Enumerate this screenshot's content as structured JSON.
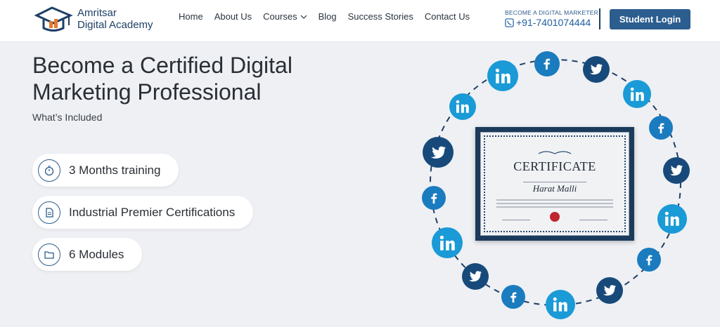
{
  "header": {
    "logo_line1": "Amritsar",
    "logo_line2": "Digital Academy",
    "nav": [
      {
        "label": "Home"
      },
      {
        "label": "About Us"
      },
      {
        "label": "Courses"
      },
      {
        "label": "Blog"
      },
      {
        "label": "Success Stories"
      },
      {
        "label": "Contact Us"
      }
    ],
    "contact_label": "BECOME A DIGITAL MARKETER",
    "contact_phone": "+91-7401074444",
    "login_label": "Student Login"
  },
  "hero": {
    "title": "Become a Certified Digital Marketing Professional",
    "subtitle": "What’s Included",
    "features": [
      {
        "label": "3 Months training",
        "icon": "stopwatch-icon"
      },
      {
        "label": "Industrial Premier Certifications",
        "icon": "document-icon"
      },
      {
        "label": "6 Modules",
        "icon": "folder-icon"
      }
    ]
  },
  "certificate": {
    "title": "CERTIFICATE",
    "name": "Harat Malli"
  },
  "social_icons": [
    {
      "type": "linkedin",
      "color": "#1a9ad6"
    },
    {
      "type": "facebook",
      "color": "#1a7bbf"
    },
    {
      "type": "twitter",
      "color": "#174a7a"
    },
    {
      "type": "linkedin",
      "color": "#1a9ad6"
    },
    {
      "type": "facebook",
      "color": "#1a7bbf"
    },
    {
      "type": "twitter",
      "color": "#174a7a"
    },
    {
      "type": "linkedin",
      "color": "#1a9ad6"
    },
    {
      "type": "facebook",
      "color": "#1a7bbf"
    },
    {
      "type": "twitter",
      "color": "#174a7a"
    },
    {
      "type": "linkedin",
      "color": "#1a9ad6"
    },
    {
      "type": "facebook",
      "color": "#1a7bbf"
    },
    {
      "type": "twitter",
      "color": "#174a7a"
    },
    {
      "type": "linkedin",
      "color": "#1a9ad6"
    },
    {
      "type": "facebook",
      "color": "#1a7bbf"
    },
    {
      "type": "twitter",
      "color": "#174a7a"
    },
    {
      "type": "linkedin",
      "color": "#1a9ad6"
    }
  ],
  "colors": {
    "brand": "#2c5d8f",
    "background": "#eef0f4"
  }
}
